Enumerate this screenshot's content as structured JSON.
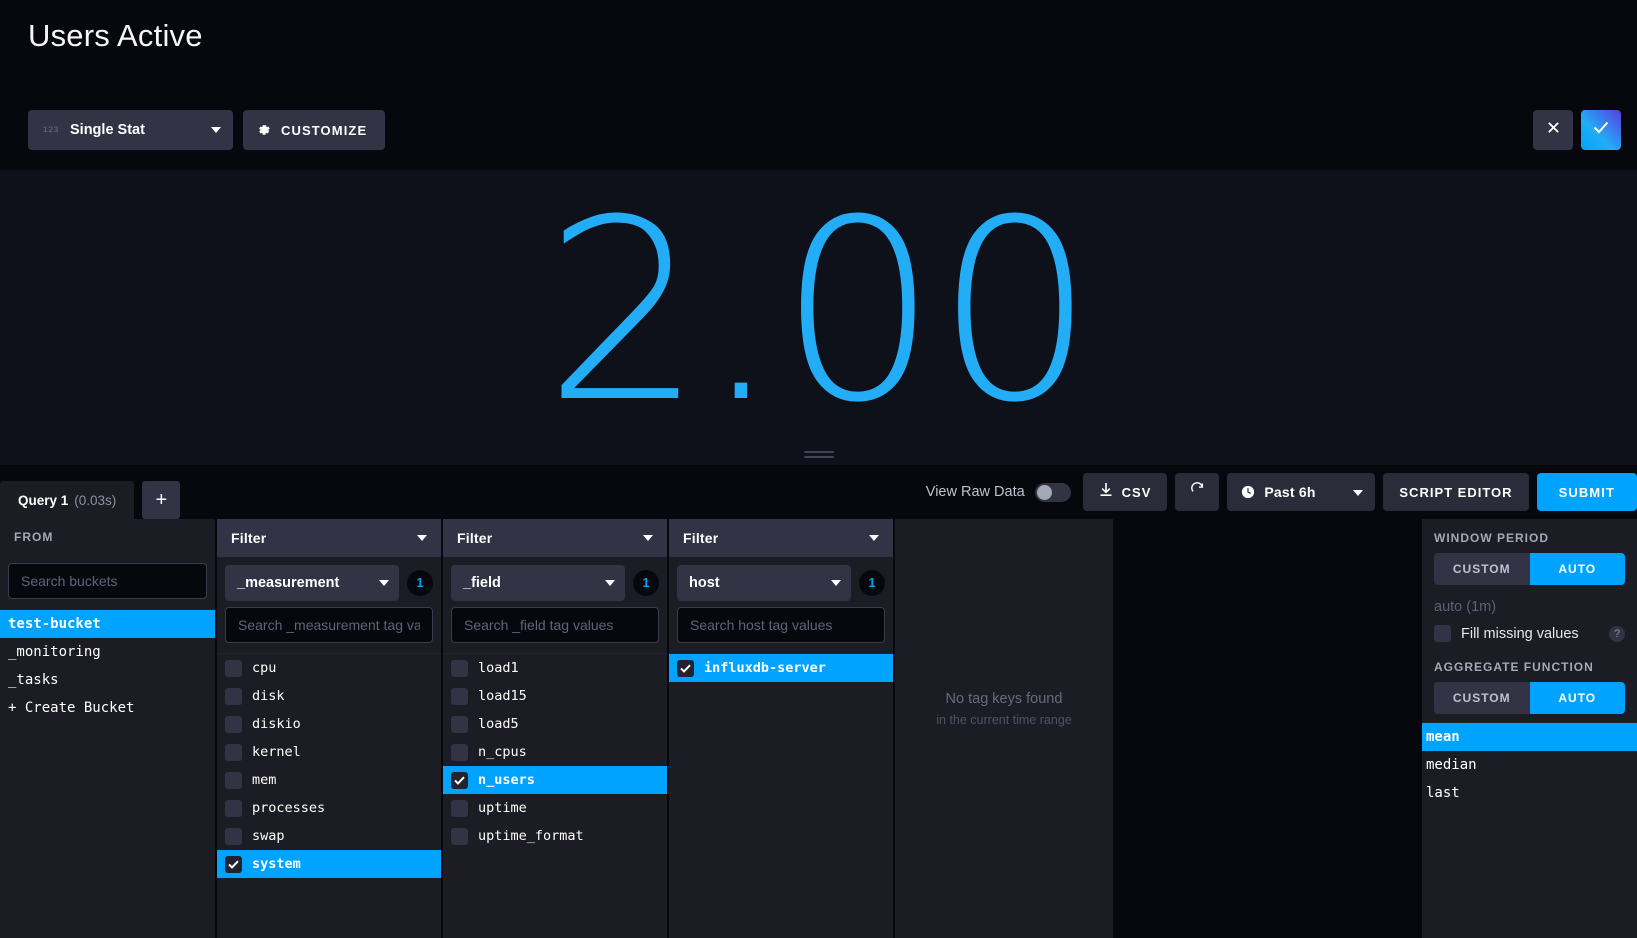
{
  "header": {
    "title": "Users Active",
    "viz_type": "Single Stat",
    "viz_icon": "single-stat-icon",
    "customize_label": "CUSTOMIZE",
    "gear_icon": "gear-icon",
    "dismiss_icon": "close-icon",
    "confirm_icon": "check-icon",
    "accent_color": "#00A3FF"
  },
  "visualization": {
    "value": "2.00",
    "color": "#22ADF6",
    "type": "single-stat"
  },
  "query_bar": {
    "query_tab_name": "Query 1",
    "query_tab_time": "(0.03s)",
    "add_query_label": "+",
    "raw_data_label": "View Raw Data",
    "raw_data_on": false,
    "csv_label": "CSV",
    "csv_icon": "download-icon",
    "refresh_icon": "refresh-icon",
    "time_range": "Past 6h",
    "clock_icon": "clock-icon",
    "script_editor_label": "SCRIPT EDITOR",
    "submit_label": "SUBMIT"
  },
  "from_panel": {
    "header": "FROM",
    "search_placeholder": "Search buckets",
    "search_value": "",
    "buckets": [
      {
        "name": "test-bucket",
        "selected": true
      },
      {
        "name": "_monitoring",
        "selected": false
      },
      {
        "name": "_tasks",
        "selected": false
      },
      {
        "name": "+ Create Bucket",
        "selected": false,
        "is_action": true
      }
    ]
  },
  "filters": [
    {
      "header": "Filter",
      "tag_key": "_measurement",
      "count": "1",
      "search_placeholder": "Search _measurement tag va",
      "closable": false,
      "values": [
        {
          "name": "cpu",
          "checked": false
        },
        {
          "name": "disk",
          "checked": false
        },
        {
          "name": "diskio",
          "checked": false
        },
        {
          "name": "kernel",
          "checked": false
        },
        {
          "name": "mem",
          "checked": false
        },
        {
          "name": "processes",
          "checked": false
        },
        {
          "name": "swap",
          "checked": false
        },
        {
          "name": "system",
          "checked": true
        }
      ]
    },
    {
      "header": "Filter",
      "tag_key": "_field",
      "count": "1",
      "search_placeholder": "Search _field tag values",
      "closable": true,
      "values": [
        {
          "name": "load1",
          "checked": false
        },
        {
          "name": "load15",
          "checked": false
        },
        {
          "name": "load5",
          "checked": false
        },
        {
          "name": "n_cpus",
          "checked": false
        },
        {
          "name": "n_users",
          "checked": true
        },
        {
          "name": "uptime",
          "checked": false
        },
        {
          "name": "uptime_format",
          "checked": false
        }
      ]
    },
    {
      "header": "Filter",
      "tag_key": "host",
      "count": "1",
      "search_placeholder": "Search host tag values",
      "closable": true,
      "values": [
        {
          "name": "influxdb-server",
          "checked": true
        }
      ]
    }
  ],
  "empty_panel": {
    "line1": "No tag keys found",
    "line2": "in the current time range"
  },
  "right_panel": {
    "window_period_label": "WINDOW PERIOD",
    "window_custom": "CUSTOM",
    "window_auto": "AUTO",
    "window_mode": "AUTO",
    "auto_value": "auto (1m)",
    "fill_missing_label": "Fill missing values",
    "fill_missing_checked": false,
    "help_icon": "question-icon",
    "aggregate_label": "AGGREGATE FUNCTION",
    "agg_custom": "CUSTOM",
    "agg_auto": "AUTO",
    "agg_mode": "AUTO",
    "functions": [
      {
        "name": "mean",
        "selected": true
      },
      {
        "name": "median",
        "selected": false
      },
      {
        "name": "last",
        "selected": false
      }
    ]
  }
}
